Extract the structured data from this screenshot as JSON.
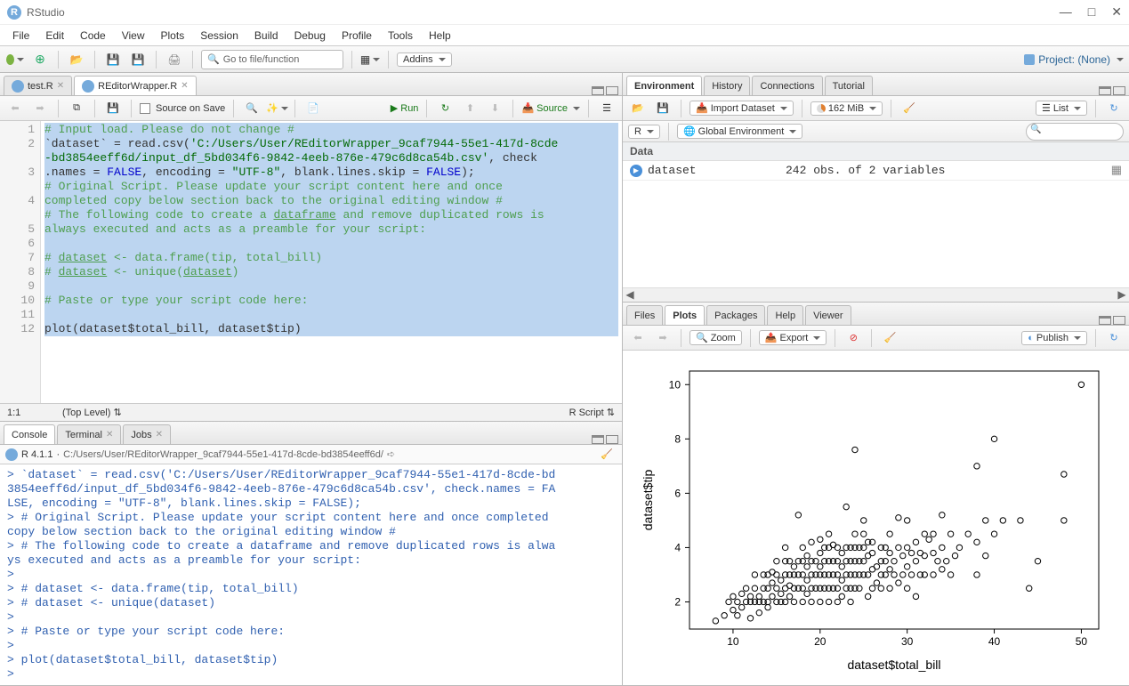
{
  "app": {
    "title": "RStudio"
  },
  "menubar": [
    "File",
    "Edit",
    "Code",
    "View",
    "Plots",
    "Session",
    "Build",
    "Debug",
    "Profile",
    "Tools",
    "Help"
  ],
  "toolbar": {
    "goto_placeholder": "Go to file/function",
    "addins": "Addins",
    "project": "Project: (None)"
  },
  "source": {
    "tabs": [
      {
        "label": "test.R"
      },
      {
        "label": "REditorWrapper.R"
      }
    ],
    "source_on_save": "Source on Save",
    "run": "Run",
    "source_btn": "Source",
    "cursor_pos": "1:1",
    "scope": "(Top Level)",
    "lang": "R Script",
    "gutter_lines": [
      "1",
      "2",
      "",
      "3",
      "",
      "4",
      "",
      "5",
      "6",
      "7",
      "8",
      "9",
      "10",
      "11",
      "12"
    ],
    "code_lines": [
      {
        "sel": true,
        "html": "<span class='c-comment'># Input load. Please do not change #</span>"
      },
      {
        "sel": true,
        "html": "<span class='c-ident'>`dataset`</span> = read.csv(<span class='c-str'>'C:/Users/User/REditorWrapper_9caf7944-55e1-417d-8cde</span>"
      },
      {
        "sel": true,
        "html": "<span class='c-str'>-bd3854eeff6d/input_df_5bd034f6-9842-4eeb-876e-479c6d8ca54b.csv'</span>, check"
      },
      {
        "sel": true,
        "html": ".names = <span class='c-kw'>FALSE</span>, encoding = <span class='c-str'>\"UTF-8\"</span>, blank.lines.skip = <span class='c-kw'>FALSE</span>);"
      },
      {
        "sel": true,
        "html": "<span class='c-comment'># Original Script. Please update your script content here and once</span>"
      },
      {
        "sel": true,
        "html": "<span class='c-comment'>completed copy below section back to the original editing window #</span>"
      },
      {
        "sel": true,
        "html": "<span class='c-comment'># The following code to create a <u>dataframe</u> and remove duplicated rows is</span>"
      },
      {
        "sel": true,
        "html": "<span class='c-comment'>always executed and acts as a preamble for your script:</span>"
      },
      {
        "sel": true,
        "html": ""
      },
      {
        "sel": true,
        "html": "<span class='c-comment'># <u>dataset</u> &lt;- data.frame(tip, total_bill)</span>"
      },
      {
        "sel": true,
        "html": "<span class='c-comment'># <u>dataset</u> &lt;- unique(<u>dataset</u>)</span>"
      },
      {
        "sel": true,
        "html": ""
      },
      {
        "sel": true,
        "html": "<span class='c-comment'># Paste or type your script code here:</span>"
      },
      {
        "sel": true,
        "html": ""
      },
      {
        "sel": true,
        "html": "plot(dataset$total_bill, dataset$tip)"
      },
      {
        "sel": false,
        "html": ""
      }
    ]
  },
  "console": {
    "tabs": [
      "Console",
      "Terminal",
      "Jobs"
    ],
    "version": "R 4.1.1",
    "path": "C:/Users/User/REditorWrapper_9caf7944-55e1-417d-8cde-bd3854eeff6d/",
    "lines": [
      "> `dataset` = read.csv('C:/Users/User/REditorWrapper_9caf7944-55e1-417d-8cde-bd",
      "3854eeff6d/input_df_5bd034f6-9842-4eeb-876e-479c6d8ca54b.csv', check.names = FA",
      "LSE, encoding = \"UTF-8\", blank.lines.skip = FALSE);",
      "> # Original Script. Please update your script content here and once completed",
      " copy below section back to the original editing window #",
      "> # The following code to create a dataframe and remove duplicated rows is alwa",
      "ys executed and acts as a preamble for your script:",
      "> ",
      "> # dataset <- data.frame(tip, total_bill)",
      "> # dataset <- unique(dataset)",
      "> ",
      "> # Paste or type your script code here:",
      "> ",
      "> plot(dataset$total_bill, dataset$tip)",
      "> "
    ]
  },
  "env": {
    "tabs": [
      "Environment",
      "History",
      "Connections",
      "Tutorial"
    ],
    "import": "Import Dataset",
    "memory": "162 MiB",
    "scope_r": "R",
    "scope_env": "Global Environment",
    "list_mode": "List",
    "data_hdr": "Data",
    "rows": [
      {
        "name": "dataset",
        "desc": "242 obs. of 2 variables"
      }
    ]
  },
  "plots": {
    "tabs": [
      "Files",
      "Plots",
      "Packages",
      "Help",
      "Viewer"
    ],
    "zoom": "Zoom",
    "export": "Export",
    "publish": "Publish"
  },
  "chart_data": {
    "type": "scatter",
    "xlabel": "dataset$total_bill",
    "ylabel": "dataset$tip",
    "xlim": [
      5,
      52
    ],
    "ylim": [
      1,
      10.5
    ],
    "xticks": [
      10,
      20,
      30,
      40,
      50
    ],
    "yticks": [
      2,
      4,
      6,
      8,
      10
    ],
    "points": [
      [
        8,
        1.3
      ],
      [
        9,
        1.5
      ],
      [
        9.5,
        2
      ],
      [
        10,
        1.7
      ],
      [
        10,
        2.2
      ],
      [
        10.5,
        1.5
      ],
      [
        10.5,
        2
      ],
      [
        11,
        1.8
      ],
      [
        11,
        2.3
      ],
      [
        11.5,
        2
      ],
      [
        11.5,
        2.5
      ],
      [
        12,
        2
      ],
      [
        12,
        2.2
      ],
      [
        12,
        1.4
      ],
      [
        12.5,
        2
      ],
      [
        12.5,
        2.5
      ],
      [
        12.5,
        3
      ],
      [
        13,
        2
      ],
      [
        13,
        2.2
      ],
      [
        13,
        1.6
      ],
      [
        13.5,
        2
      ],
      [
        13.5,
        2.5
      ],
      [
        13.5,
        3
      ],
      [
        14,
        2
      ],
      [
        14,
        2.5
      ],
      [
        14,
        3
      ],
      [
        14,
        1.8
      ],
      [
        14.5,
        2.2
      ],
      [
        14.5,
        2.7
      ],
      [
        14.5,
        3.1
      ],
      [
        15,
        2
      ],
      [
        15,
        2.5
      ],
      [
        15,
        3
      ],
      [
        15,
        3.5
      ],
      [
        15.5,
        2
      ],
      [
        15.5,
        2.3
      ],
      [
        15.5,
        2.8
      ],
      [
        16,
        2
      ],
      [
        16,
        2.5
      ],
      [
        16,
        3
      ],
      [
        16,
        3.5
      ],
      [
        16,
        4
      ],
      [
        16.5,
        2.2
      ],
      [
        16.5,
        2.6
      ],
      [
        16.5,
        3
      ],
      [
        16.5,
        3.5
      ],
      [
        17,
        2
      ],
      [
        17,
        2.5
      ],
      [
        17,
        3
      ],
      [
        17,
        3.3
      ],
      [
        17.5,
        2.5
      ],
      [
        17.5,
        3
      ],
      [
        17.5,
        3.5
      ],
      [
        17.5,
        5.2
      ],
      [
        18,
        2
      ],
      [
        18,
        2.5
      ],
      [
        18,
        3
      ],
      [
        18,
        3.5
      ],
      [
        18,
        4
      ],
      [
        18.5,
        2.3
      ],
      [
        18.5,
        2.8
      ],
      [
        18.5,
        3.3
      ],
      [
        18.5,
        3.7
      ],
      [
        19,
        2
      ],
      [
        19,
        2.5
      ],
      [
        19,
        3
      ],
      [
        19,
        3.5
      ],
      [
        19,
        4.2
      ],
      [
        19.5,
        2.5
      ],
      [
        19.5,
        3
      ],
      [
        19.5,
        3.5
      ],
      [
        20,
        2
      ],
      [
        20,
        2.5
      ],
      [
        20,
        3
      ],
      [
        20,
        3.3
      ],
      [
        20,
        3.8
      ],
      [
        20,
        4.3
      ],
      [
        20.5,
        2.5
      ],
      [
        20.5,
        3
      ],
      [
        20.5,
        3.5
      ],
      [
        20.5,
        4
      ],
      [
        21,
        2
      ],
      [
        21,
        2.5
      ],
      [
        21,
        3
      ],
      [
        21,
        3.5
      ],
      [
        21,
        4
      ],
      [
        21,
        4.5
      ],
      [
        21.5,
        2.5
      ],
      [
        21.5,
        3
      ],
      [
        21.5,
        3.5
      ],
      [
        21.5,
        4.1
      ],
      [
        22,
        2
      ],
      [
        22,
        2.5
      ],
      [
        22,
        3
      ],
      [
        22,
        3.5
      ],
      [
        22,
        4
      ],
      [
        22.5,
        2.2
      ],
      [
        22.5,
        2.8
      ],
      [
        22.5,
        3.3
      ],
      [
        22.5,
        3.8
      ],
      [
        23,
        2.5
      ],
      [
        23,
        3
      ],
      [
        23,
        3.5
      ],
      [
        23,
        4
      ],
      [
        23,
        5.5
      ],
      [
        23.5,
        2
      ],
      [
        23.5,
        2.5
      ],
      [
        23.5,
        3
      ],
      [
        23.5,
        3.5
      ],
      [
        23.5,
        4
      ],
      [
        24,
        2.5
      ],
      [
        24,
        3
      ],
      [
        24,
        3.5
      ],
      [
        24,
        4
      ],
      [
        24,
        4.5
      ],
      [
        24,
        7.6
      ],
      [
        24.5,
        2.5
      ],
      [
        24.5,
        3
      ],
      [
        24.5,
        3.5
      ],
      [
        24.5,
        4
      ],
      [
        25,
        3
      ],
      [
        25,
        3.5
      ],
      [
        25,
        4
      ],
      [
        25,
        4.5
      ],
      [
        25,
        5
      ],
      [
        25.5,
        2.2
      ],
      [
        25.5,
        3
      ],
      [
        25.5,
        3.7
      ],
      [
        25.5,
        4.2
      ],
      [
        26,
        2.5
      ],
      [
        26,
        3.2
      ],
      [
        26,
        3.8
      ],
      [
        26,
        4.2
      ],
      [
        26.5,
        2.7
      ],
      [
        26.5,
        3.3
      ],
      [
        27,
        2.5
      ],
      [
        27,
        3
      ],
      [
        27,
        3.5
      ],
      [
        27,
        4
      ],
      [
        27.5,
        3
      ],
      [
        27.5,
        3.5
      ],
      [
        27.5,
        4
      ],
      [
        28,
        2.5
      ],
      [
        28,
        3.2
      ],
      [
        28,
        3.8
      ],
      [
        28,
        4.5
      ],
      [
        28.5,
        3
      ],
      [
        28.5,
        3.5
      ],
      [
        29,
        2.7
      ],
      [
        29,
        4
      ],
      [
        29,
        5.1
      ],
      [
        29.5,
        3
      ],
      [
        29.5,
        3.7
      ],
      [
        30,
        2.5
      ],
      [
        30,
        3.3
      ],
      [
        30,
        4
      ],
      [
        30,
        5
      ],
      [
        30.5,
        3
      ],
      [
        30.5,
        3.8
      ],
      [
        31,
        2.2
      ],
      [
        31,
        3.5
      ],
      [
        31,
        4.2
      ],
      [
        31.5,
        3
      ],
      [
        31.5,
        3.8
      ],
      [
        32,
        3
      ],
      [
        32,
        3.7
      ],
      [
        32,
        4.5
      ],
      [
        32.5,
        4.3
      ],
      [
        33,
        3
      ],
      [
        33,
        3.8
      ],
      [
        33,
        4.5
      ],
      [
        33.5,
        3.5
      ],
      [
        34,
        3.2
      ],
      [
        34,
        4
      ],
      [
        34,
        5.2
      ],
      [
        34.5,
        3.5
      ],
      [
        35,
        3
      ],
      [
        35,
        4.5
      ],
      [
        35.5,
        3.7
      ],
      [
        36,
        4
      ],
      [
        37,
        4.5
      ],
      [
        38,
        3
      ],
      [
        38,
        4.2
      ],
      [
        38,
        7
      ],
      [
        39,
        3.7
      ],
      [
        39,
        5
      ],
      [
        40,
        4.5
      ],
      [
        40,
        8
      ],
      [
        41,
        5
      ],
      [
        43,
        5
      ],
      [
        44,
        2.5
      ],
      [
        45,
        3.5
      ],
      [
        48,
        5
      ],
      [
        48,
        6.7
      ],
      [
        50,
        10
      ]
    ]
  }
}
